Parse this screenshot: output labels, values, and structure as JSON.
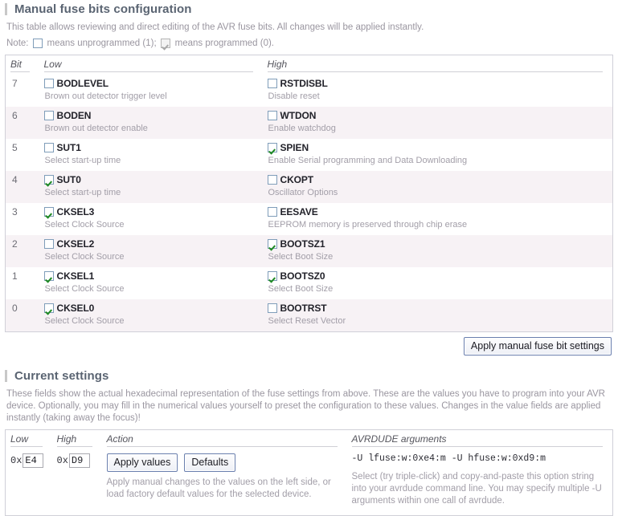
{
  "manual_section": {
    "heading": "Manual fuse bits configuration",
    "description": "This table allows reviewing and direct editing of the AVR fuse bits. All changes will be applied instantly.",
    "note": {
      "label": "Note:",
      "unprogrammed_text": "means unprogrammed (1);",
      "programmed_text": "means programmed (0)."
    },
    "columns": {
      "bit": "Bit",
      "low": "Low",
      "high": "High"
    },
    "rows": [
      {
        "bit": "7",
        "low": {
          "name": "BODLEVEL",
          "desc": "Brown out detector trigger level",
          "checked": false
        },
        "high": {
          "name": "RSTDISBL",
          "desc": "Disable reset",
          "checked": false
        }
      },
      {
        "bit": "6",
        "low": {
          "name": "BODEN",
          "desc": "Brown out detector enable",
          "checked": false
        },
        "high": {
          "name": "WTDON",
          "desc": "Enable watchdog",
          "checked": false
        }
      },
      {
        "bit": "5",
        "low": {
          "name": "SUT1",
          "desc": "Select start-up time",
          "checked": false
        },
        "high": {
          "name": "SPIEN",
          "desc": "Enable Serial programming and Data Downloading",
          "checked": true
        }
      },
      {
        "bit": "4",
        "low": {
          "name": "SUT0",
          "desc": "Select start-up time",
          "checked": true
        },
        "high": {
          "name": "CKOPT",
          "desc": "Oscillator Options",
          "checked": false
        }
      },
      {
        "bit": "3",
        "low": {
          "name": "CKSEL3",
          "desc": "Select Clock Source",
          "checked": true
        },
        "high": {
          "name": "EESAVE",
          "desc": "EEPROM memory is preserved through chip erase",
          "checked": false
        }
      },
      {
        "bit": "2",
        "low": {
          "name": "CKSEL2",
          "desc": "Select Clock Source",
          "checked": false
        },
        "high": {
          "name": "BOOTSZ1",
          "desc": "Select Boot Size",
          "checked": true
        }
      },
      {
        "bit": "1",
        "low": {
          "name": "CKSEL1",
          "desc": "Select Clock Source",
          "checked": true
        },
        "high": {
          "name": "BOOTSZ0",
          "desc": "Select Boot Size",
          "checked": true
        }
      },
      {
        "bit": "0",
        "low": {
          "name": "CKSEL0",
          "desc": "Select Clock Source",
          "checked": true
        },
        "high": {
          "name": "BOOTRST",
          "desc": "Select Reset Vector",
          "checked": false
        }
      }
    ],
    "apply_button": "Apply manual fuse bit settings"
  },
  "current_settings": {
    "heading": "Current settings",
    "description": "These fields show the actual hexadecimal representation of the fuse settings from above. These are the values you have to program into your AVR device. Optionally, you may fill in the numerical values yourself to preset the configuration to these values. Changes in the value fields are applied instantly (taking away the focus)!",
    "columns": {
      "low": "Low",
      "high": "High",
      "action": "Action",
      "avrdude": "AVRDUDE arguments"
    },
    "hex_prefix": "0x",
    "low_value": "E4",
    "high_value": "D9",
    "apply_values_button": "Apply values",
    "defaults_button": "Defaults",
    "action_desc": "Apply manual changes to the values on the left side, or load factory default values for the selected device.",
    "avrdude_args": "-U lfuse:w:0xe4:m  -U hfuse:w:0xd9:m",
    "avrdude_desc": "Select (try triple-click) and copy-and-paste this option string into your avrdude command line. You may specify multiple -U arguments within one call of avrdude."
  },
  "colors": {
    "heading": "#5a6472",
    "accent_bar": "#c8c8c8",
    "muted_text": "#9a96a0",
    "row_stripe": "#f7f2f5",
    "table_border": "#d0d0d8",
    "checkbox_border": "#7f9db9",
    "check_green": "#1f8a24",
    "button_border": "#6a7fae"
  }
}
